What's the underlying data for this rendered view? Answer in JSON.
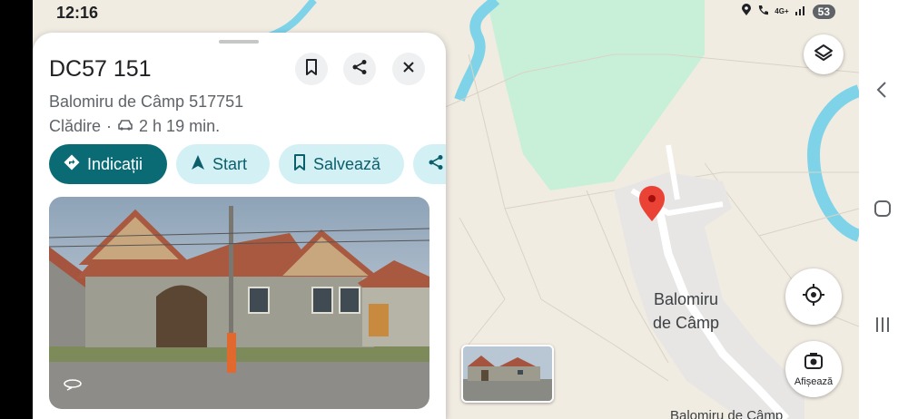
{
  "status_bar": {
    "time": "12:16",
    "network": "4G+",
    "battery": "53"
  },
  "place": {
    "title": "DC57 151",
    "address": "Balomiru de Câmp 517751",
    "category": "Clădire",
    "separator": "·",
    "drive_time": "2 h 19 min."
  },
  "actions": [
    {
      "label": "Indicații",
      "icon": "directions-icon"
    },
    {
      "label": "Start",
      "icon": "navigation-arrow-icon"
    },
    {
      "label": "Salvează",
      "icon": "bookmark-icon"
    },
    {
      "label": "",
      "icon": "share-icon"
    }
  ],
  "header_buttons": [
    "bookmark-icon",
    "share-icon",
    "close-icon"
  ],
  "map": {
    "place_label_line1": "Balomiru",
    "place_label_line2": "de Câmp",
    "bottom_label": "Balomiru de Câmp",
    "show_button_label": "Afișează"
  },
  "colors": {
    "primary": "#0b6b74",
    "chip_bg": "#d3f0f5",
    "water": "#7fd3e8",
    "green_area": "#c8f0d9",
    "pin": "#ea4335"
  }
}
